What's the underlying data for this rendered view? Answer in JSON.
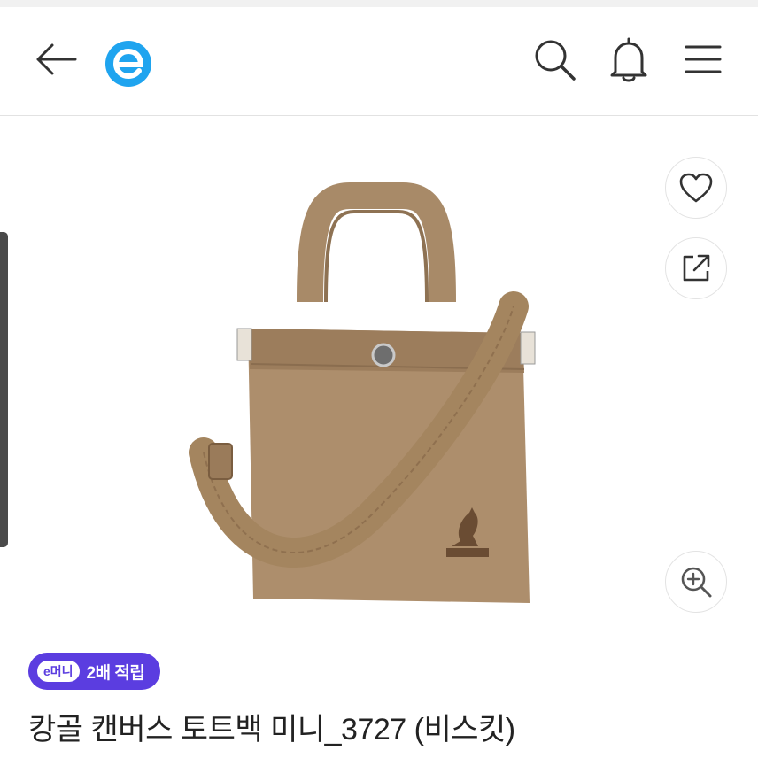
{
  "header": {
    "back_icon": "arrow-left-icon",
    "logo_icon": "e-logo-icon",
    "search_icon": "search-icon",
    "bell_icon": "bell-icon",
    "menu_icon": "hamburger-menu-icon",
    "brand_color": "#1fa4ef"
  },
  "product": {
    "image_icon": "tote-bag-image",
    "brand_mark": "KANGOL",
    "wishlist_icon": "heart-icon",
    "share_icon": "share-icon",
    "zoom_icon": "zoom-in-icon",
    "badge": {
      "pill_label": "e머니",
      "text": "2배 적립",
      "color": "#5b3de0"
    },
    "title": "캉골 캔버스 토트백 미니_3727 (비스킷)"
  }
}
